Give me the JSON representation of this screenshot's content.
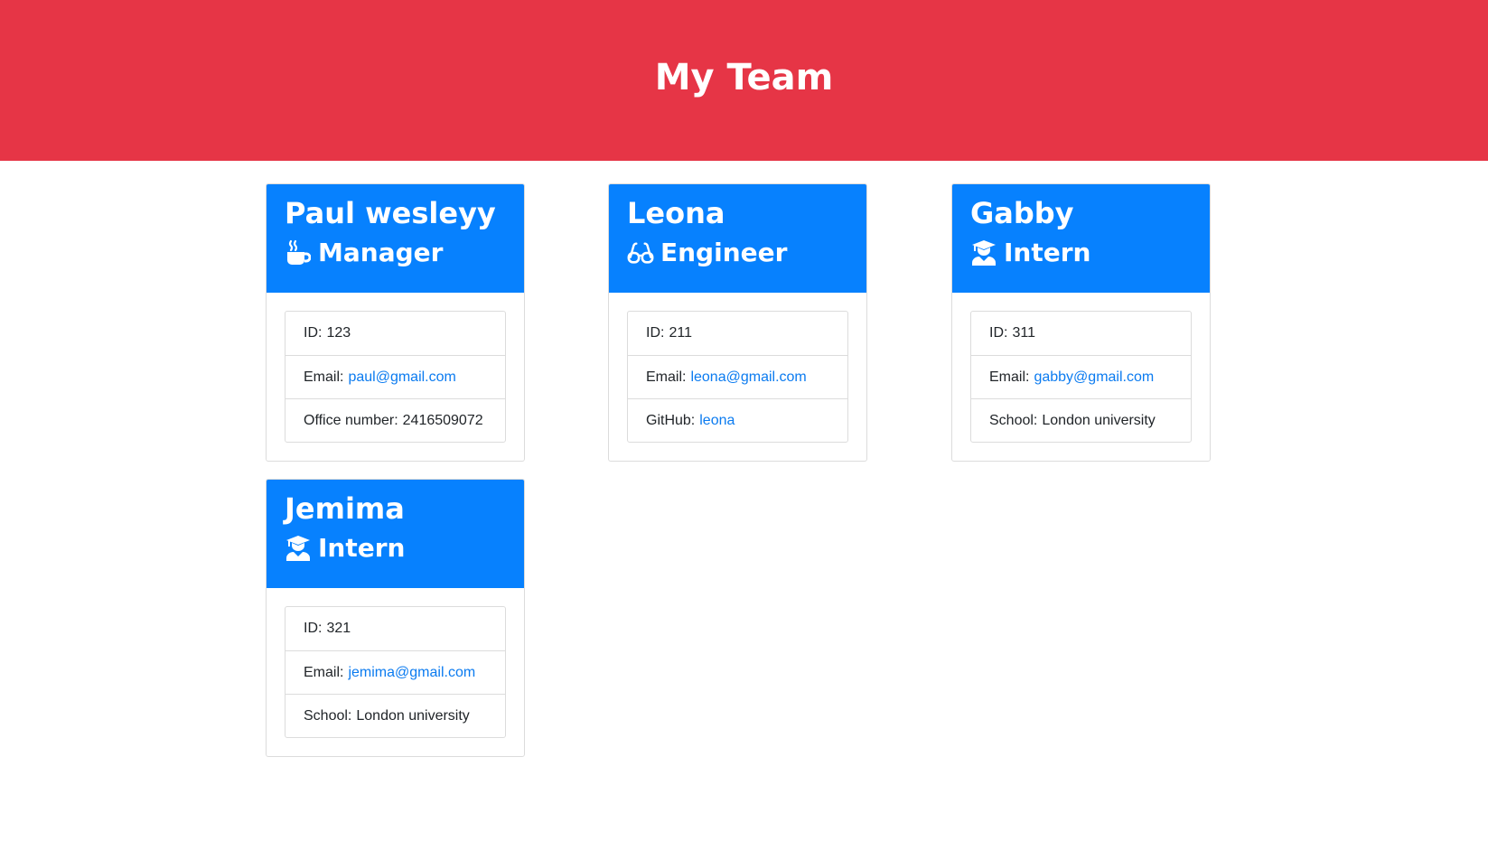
{
  "header": {
    "title": "My Team"
  },
  "team": [
    {
      "name": "Paul wesleyy",
      "role": "Manager",
      "role_icon": "coffee-mug-icon",
      "id_label": "ID:",
      "id": "123",
      "email_label": "Email:",
      "email": "paul@gmail.com",
      "extra_label": "Office number:",
      "extra_value": "2416509072"
    },
    {
      "name": "Leona",
      "role": "Engineer",
      "role_icon": "glasses-icon",
      "id_label": "ID:",
      "id": "211",
      "email_label": "Email:",
      "email": "leona@gmail.com",
      "extra_label": "GitHub:",
      "extra_value": "leona"
    },
    {
      "name": "Gabby",
      "role": "Intern",
      "role_icon": "graduate-user-icon",
      "id_label": "ID:",
      "id": "311",
      "email_label": "Email:",
      "email": "gabby@gmail.com",
      "extra_label": "School:",
      "extra_value": "London university"
    },
    {
      "name": "Jemima",
      "role": "Intern",
      "role_icon": "graduate-user-icon",
      "id_label": "ID:",
      "id": "321",
      "email_label": "Email:",
      "email": "jemima@gmail.com",
      "extra_label": "School:",
      "extra_value": "London university"
    }
  ],
  "colors": {
    "header_bg": "#e63546",
    "card_header_bg": "#0781fe",
    "link": "#0b7bf0"
  }
}
